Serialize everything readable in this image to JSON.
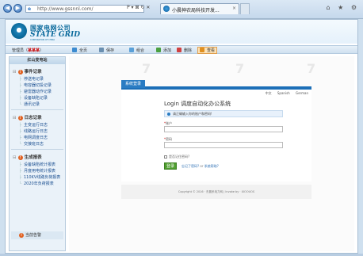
{
  "browser": {
    "address": "http://www.gssnnl.com/",
    "tab_title": "小晨神农局科技开发...",
    "back_glyph": "◀",
    "forward_glyph": "▶",
    "address_icons": "P ▾ ⊠ ↻ ✕",
    "right_icons": [
      "⌂",
      "★",
      "⚙"
    ]
  },
  "header": {
    "logo_cn": "国家电网公司",
    "logo_en": "STATE GRID",
    "logo_sub": "CORPORATION OF CHINA"
  },
  "toolbar": {
    "user_prefix": "管理员（",
    "user_name": "某某某",
    "user_suffix": "）",
    "items": [
      {
        "label": "全页",
        "color": "#3c8bd0"
      },
      {
        "label": "保存",
        "color": "#6a8fb0"
      },
      {
        "label": "组合",
        "color": "#5aa0d8"
      },
      {
        "label": "添加",
        "color": "#4aa040"
      },
      {
        "label": "删除",
        "color": "#d04040"
      },
      {
        "label": "查看",
        "color": "#e09020"
      }
    ]
  },
  "sidebar": {
    "title": "红山变电站",
    "sections": [
      {
        "label": "事件记录",
        "items": [
          "停送电记录",
          "电容器切投记录",
          "避雷器动作记录",
          "设备缺陷记录",
          "通讯记录"
        ]
      },
      {
        "label": "日志记录",
        "items": [
          "主变运行日志",
          "线路运行日志",
          "电网调度日志",
          "交接班日志"
        ]
      },
      {
        "label": "生成报表",
        "items": [
          "设备缺陷统计报表",
          "月度用电统计报表",
          "110KV线路负荷报表",
          "2020年负荷报表"
        ]
      }
    ],
    "bottom": "当前告警"
  },
  "login": {
    "tab": "系统登录",
    "lang_cn": "中文",
    "lang_es": "Spanish",
    "lang_de": "German",
    "title": "Login 调度自动化办公系统",
    "notice": "请正确输入你的账户和密码!",
    "account_label": "账户",
    "password_label": "密码",
    "remember": "是否记住密码?",
    "button": "登录",
    "forgot": "忘记了密码?",
    "or": "or",
    "help": "系统帮助?",
    "footer": "Copyright © 2016 · 东晨系电力网 | Invoke by · XIOOUOS"
  }
}
